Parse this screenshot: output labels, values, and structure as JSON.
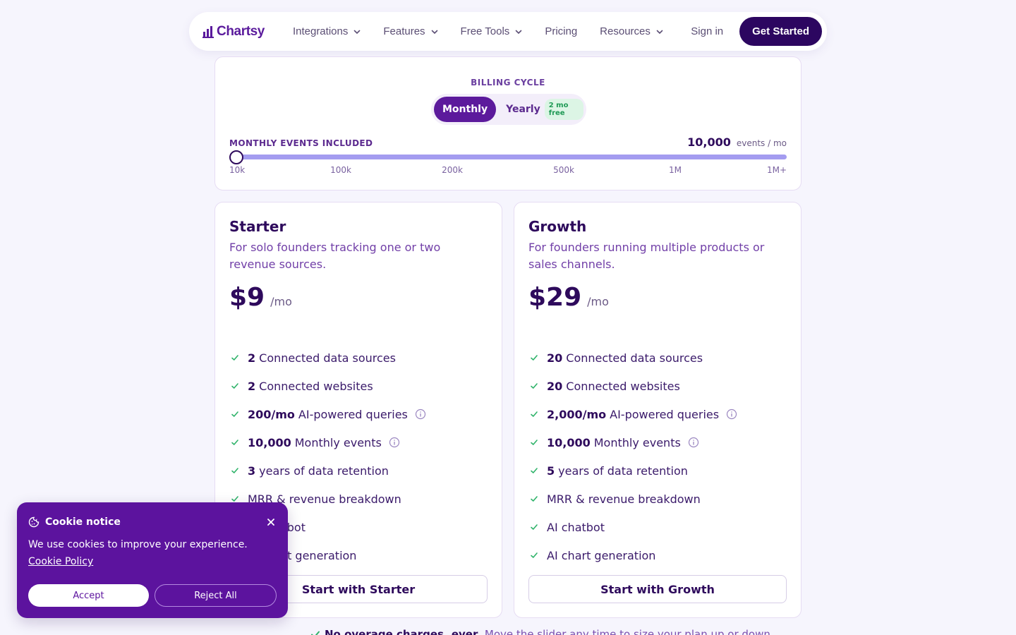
{
  "nav": {
    "logo_text": "Chartsy",
    "items": [
      {
        "label": "Integrations",
        "has_dropdown": true
      },
      {
        "label": "Features",
        "has_dropdown": true
      },
      {
        "label": "Free Tools",
        "has_dropdown": true
      },
      {
        "label": "Pricing",
        "has_dropdown": false
      },
      {
        "label": "Resources",
        "has_dropdown": true
      }
    ],
    "signin_label": "Sign in",
    "cta_label": "Get Started"
  },
  "billing": {
    "label": "BILLING CYCLE",
    "monthly_label": "Monthly",
    "yearly_label": "Yearly",
    "yearly_badge": "2 mo free",
    "selected": "Monthly",
    "events_label": "MONTHLY EVENTS INCLUDED",
    "events_value": "10,000",
    "events_unit": "events / mo",
    "slider_position": 0,
    "slider_ticks": [
      "10k",
      "100k",
      "200k",
      "500k",
      "1M",
      "1M+"
    ]
  },
  "plans": [
    {
      "name": "Starter",
      "description": "For solo founders tracking one or two revenue sources.",
      "price": "$9",
      "period": "/mo",
      "features": [
        {
          "bold": "2",
          "text": "Connected data sources",
          "info": false
        },
        {
          "bold": "2",
          "text": "Connected websites",
          "info": false
        },
        {
          "bold": "200/mo",
          "text": "AI-powered queries",
          "info": true
        },
        {
          "bold": "10,000",
          "text": "Monthly events",
          "info": true
        },
        {
          "bold": "3",
          "text": "years of data retention",
          "info": false
        },
        {
          "bold": "",
          "text": "MRR & revenue breakdown",
          "info": false
        },
        {
          "bold": "",
          "text": "AI chatbot",
          "info": false
        },
        {
          "bold": "",
          "text": "AI chart generation",
          "info": false
        }
      ],
      "cta": "Start with Starter"
    },
    {
      "name": "Growth",
      "description": "For founders running multiple products or sales channels.",
      "price": "$29",
      "period": "/mo",
      "features": [
        {
          "bold": "20",
          "text": "Connected data sources",
          "info": false
        },
        {
          "bold": "20",
          "text": "Connected websites",
          "info": false
        },
        {
          "bold": "2,000/mo",
          "text": "AI-powered queries",
          "info": true
        },
        {
          "bold": "10,000",
          "text": "Monthly events",
          "info": true
        },
        {
          "bold": "5",
          "text": "years of data retention",
          "info": false
        },
        {
          "bold": "",
          "text": "MRR & revenue breakdown",
          "info": false
        },
        {
          "bold": "",
          "text": "AI chatbot",
          "info": false
        },
        {
          "bold": "",
          "text": "AI chart generation",
          "info": false
        }
      ],
      "cta": "Start with Growth"
    }
  ],
  "footnote": {
    "bold": "No overage charges, ever.",
    "text": "Move the slider any time to size your plan up or down."
  },
  "cookie": {
    "title": "Cookie notice",
    "text": "We use cookies to improve your experience.",
    "link_text": "Cookie Policy",
    "accept_label": "Accept",
    "reject_label": "Reject All"
  },
  "colors": {
    "brand": "#5c139e",
    "dark": "#2e0a5c",
    "slider": "#a49cf0",
    "check": "#2fb36a"
  },
  "icons": {
    "logo": "bar-chart-logo-icon",
    "dropdown": "chevron-down-icon",
    "feature_check": "check-icon",
    "info": "info-icon",
    "cookie": "cookie-icon",
    "close": "close-icon"
  }
}
